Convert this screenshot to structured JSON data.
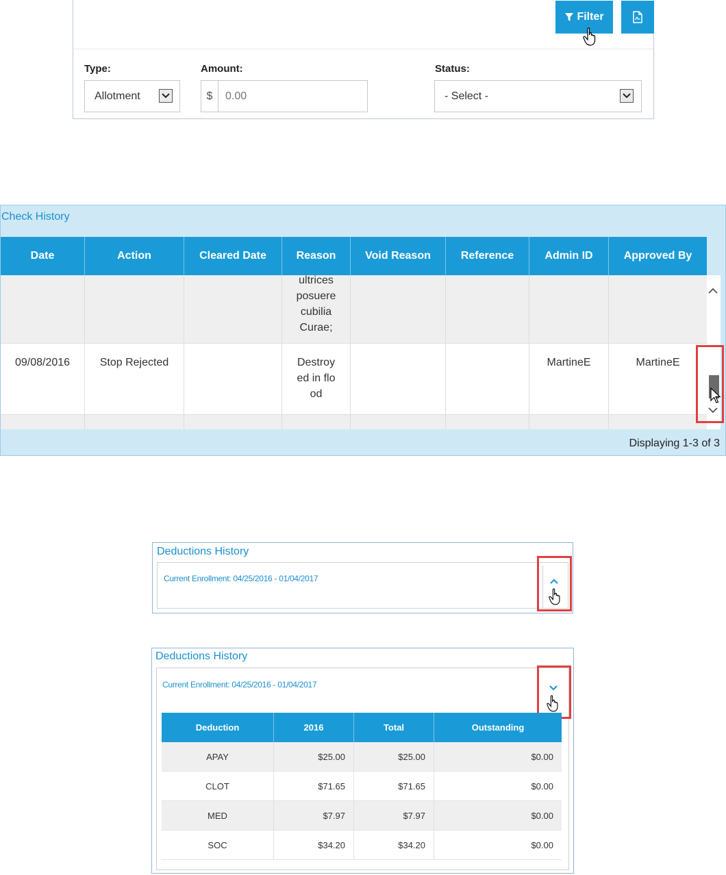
{
  "filter": {
    "filter_label": "Filter",
    "type_label": "Type:",
    "type_value": "Allotment",
    "amount_label": "Amount:",
    "amount_prefix": "$",
    "amount_placeholder": "0.00",
    "status_label": "Status:",
    "status_value": "- Select -"
  },
  "check_history": {
    "title": "Check History",
    "columns": [
      "Date",
      "Action",
      "Cleared Date",
      "Reason",
      "Void Reason",
      "Reference",
      "Admin ID",
      "Approved By"
    ],
    "rows": [
      {
        "date": "",
        "action": "",
        "cleared_date": "",
        "reason": "ultrices posuere cubilia Curae;",
        "void_reason": "",
        "reference": "",
        "admin_id": "",
        "approved_by": ""
      },
      {
        "date": "09/08/2016",
        "action": "Stop Rejected",
        "cleared_date": "",
        "reason": "Destroy ed in flo od",
        "void_reason": "",
        "reference": "",
        "admin_id": "MartineE",
        "approved_by": "MartineE"
      }
    ],
    "footer": "Displaying 1-3 of 3"
  },
  "deductions_collapsed": {
    "title": "Deductions History",
    "enrollment": "Current Enrollment: 04/25/2016 - 01/04/2017"
  },
  "deductions_expanded": {
    "title": "Deductions History",
    "enrollment": "Current Enrollment: 04/25/2016 - 01/04/2017",
    "columns": [
      "Deduction",
      "2016",
      "Total",
      "Outstanding"
    ],
    "rows": [
      {
        "deduction": "APAY",
        "y2016": "$25.00",
        "total": "$25.00",
        "outstanding": "$0.00"
      },
      {
        "deduction": "CLOT",
        "y2016": "$71.65",
        "total": "$71.65",
        "outstanding": "$0.00"
      },
      {
        "deduction": "MED",
        "y2016": "$7.97",
        "total": "$7.97",
        "outstanding": "$0.00"
      },
      {
        "deduction": "SOC",
        "y2016": "$34.20",
        "total": "$34.20",
        "outstanding": "$0.00"
      }
    ]
  },
  "colors": {
    "accent": "#1a9bd7",
    "highlight": "#e04040",
    "panel_bg": "#cfe8f6"
  },
  "icons": [
    "funnel-icon",
    "pdf-icon",
    "chevron-down-icon",
    "chevron-up-icon",
    "hand-cursor-icon",
    "arrow-cursor-icon"
  ]
}
